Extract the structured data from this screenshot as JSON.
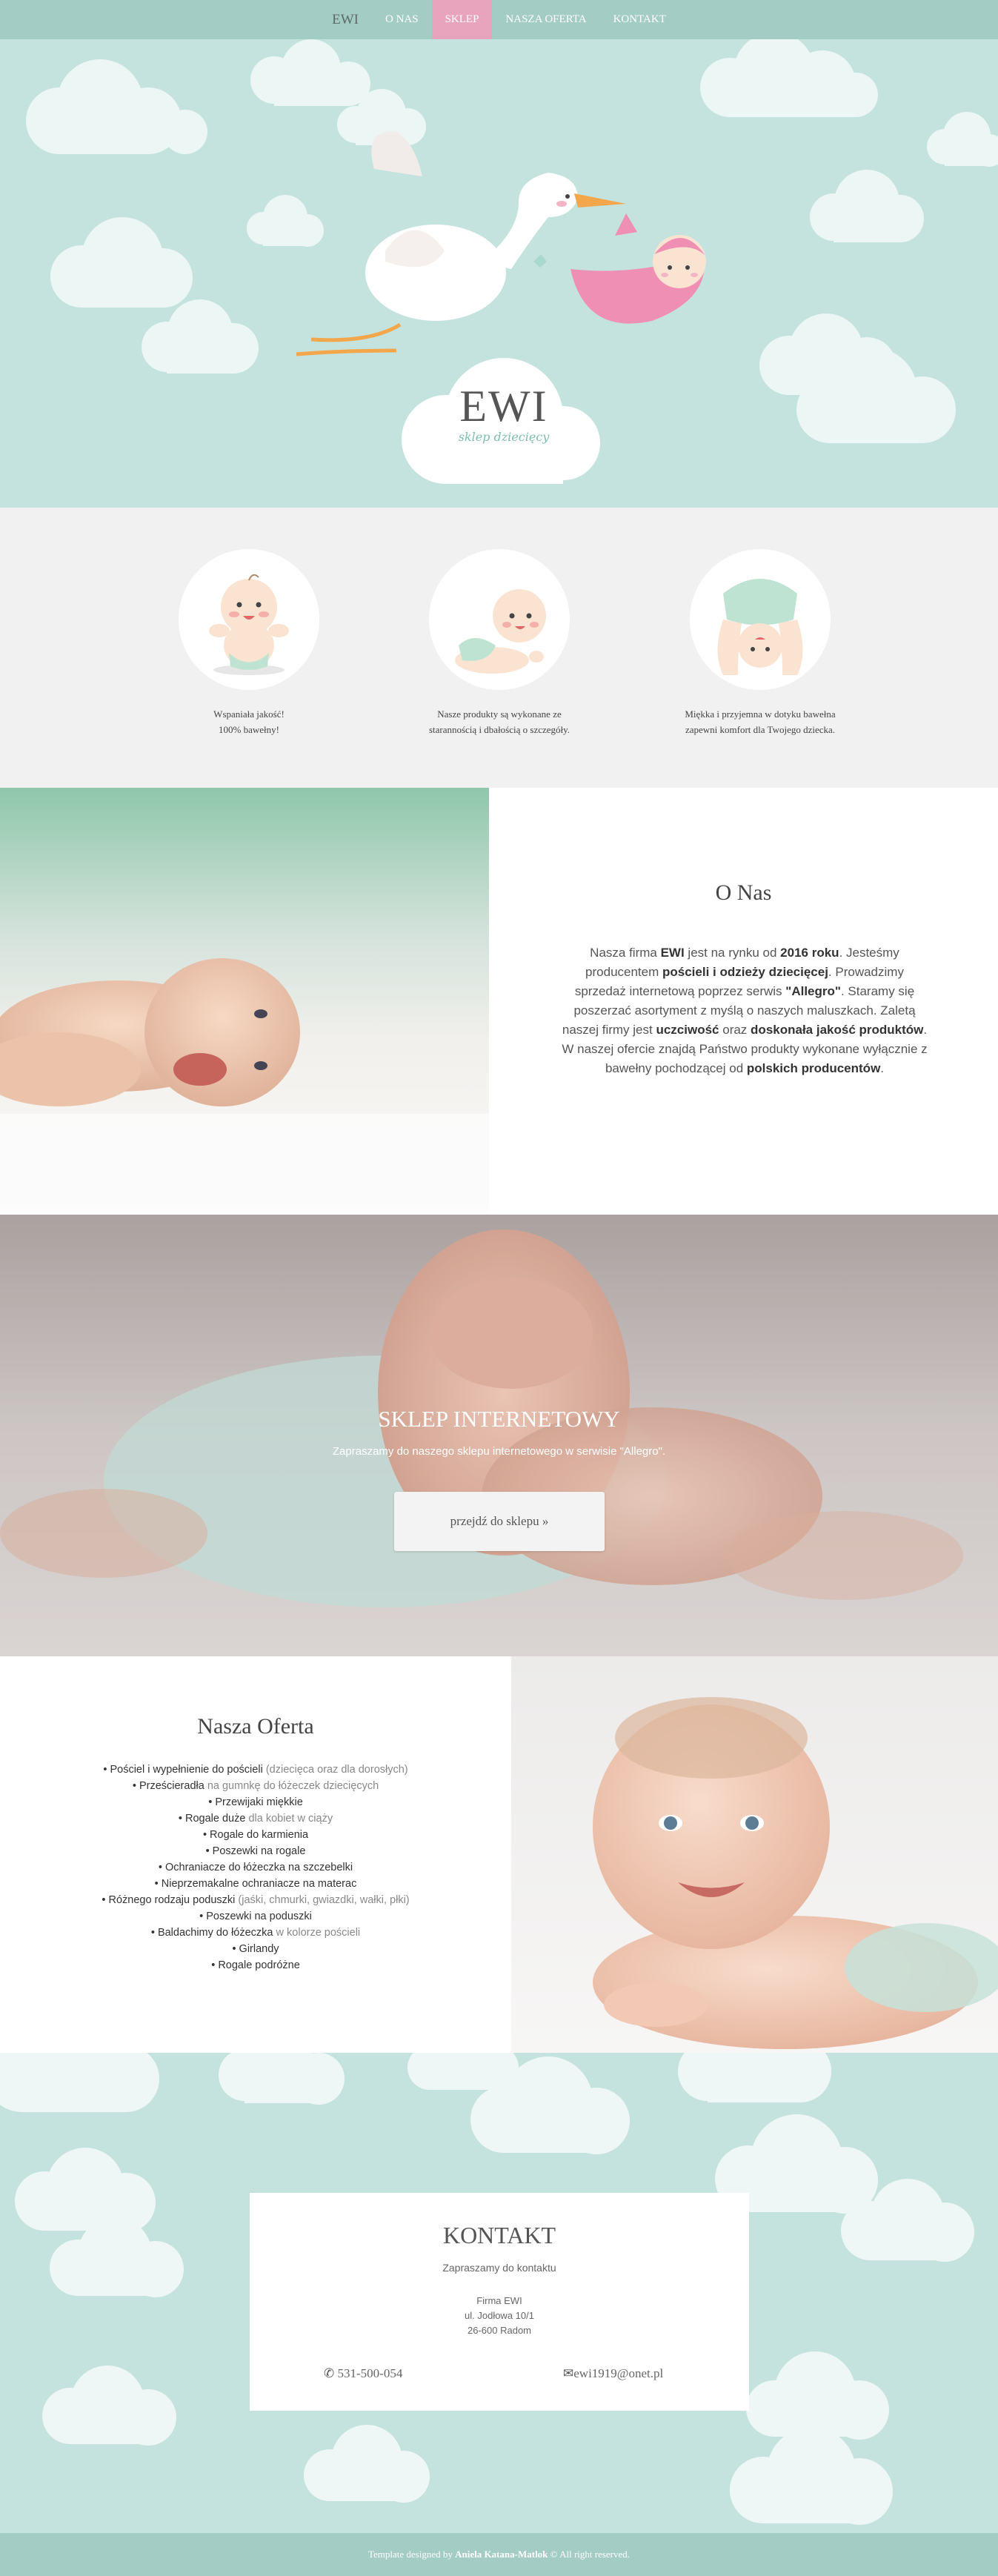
{
  "nav": {
    "brand": "EWI",
    "items": [
      "O NAS",
      "SKLEP",
      "NASZA OFERTA",
      "KONTAKT"
    ],
    "active_index": 1
  },
  "hero": {
    "logo_title": "EWI",
    "logo_subtitle": "sklep dziecięcy"
  },
  "features": [
    {
      "line1": "Wspaniała jakość!",
      "line2": "100% bawełny!"
    },
    {
      "line1": "Nasze produkty są wykonane ze",
      "line2": "starannością i dbałością o szczegóły."
    },
    {
      "line1": "Miękka i przyjemna w dotyku bawełna",
      "line2": "zapewni komfort dla Twojego dziecka."
    }
  ],
  "about": {
    "heading": "O Nas",
    "p1": "Nasza firma ",
    "b1": "EWI",
    "p2": " jest na rynku od ",
    "b2": "2016 roku",
    "p3": ". Jesteśmy producentem ",
    "b3": "pościeli i odzieży dziecięcej",
    "p4": ". Prowadzimy sprzedaż internetową poprzez serwis ",
    "b4": "\"Allegro\"",
    "p5": ". Staramy się poszerzać asortyment z myślą o naszych maluszkach. Zaletą naszej firmy jest ",
    "b5": "uczciwość",
    "p6": " oraz ",
    "b6": "doskonała jakość produktów",
    "p7": ". W naszej ofercie znajdą Państwo produkty wykonane wyłącznie z bawełny pochodzącej od ",
    "b7": "polskich producentów",
    "p8": "."
  },
  "shop": {
    "heading": "SKLEP INTERNETOWY",
    "subtitle": "Zapraszamy do naszego sklepu internetowego w serwisie \"Allegro\".",
    "button": "przejdź do sklepu »"
  },
  "offer": {
    "heading": "Nasza Oferta",
    "items": [
      {
        "main": "Pościel i wypełnienie do pościeli",
        "extra": " (dziecięca oraz dla dorosłych)"
      },
      {
        "main": "Prześcieradła",
        "extra": " na gumnkę do łóżeczek dziecięcych"
      },
      {
        "main": "Przewijaki miękkie",
        "extra": ""
      },
      {
        "main": "Rogale duże",
        "extra": " dla kobiet w ciąży"
      },
      {
        "main": "Rogale do karmienia",
        "extra": ""
      },
      {
        "main": "Poszewki na rogale",
        "extra": ""
      },
      {
        "main": "Ochraniacze do łóżeczka na szczebelki",
        "extra": ""
      },
      {
        "main": "Nieprzemakalne ochraniacze na materac",
        "extra": ""
      },
      {
        "main": "Różnego rodzaju poduszki",
        "extra": " (jaśki, chmurki, gwiazdki, wałki, płki)"
      },
      {
        "main": "Poszewki na poduszki",
        "extra": ""
      },
      {
        "main": "Baldachimy do łóżeczka",
        "extra": " w kolorze pościeli"
      },
      {
        "main": "Girlandy",
        "extra": ""
      },
      {
        "main": "Rogale podróżne",
        "extra": ""
      }
    ]
  },
  "contact": {
    "heading": "KONTAKT",
    "subtitle": "Zapraszamy do kontaktu",
    "company": "Firma EWI",
    "street": "ul. Jodłowa 10/1",
    "city": "26-600 Radom",
    "phone": "531-500-054",
    "email": "ewi1919@onet.pl"
  },
  "footer": {
    "prefix": "Template designed by ",
    "author": "Aniela Katana-Matlok",
    "suffix": " © All right reserved."
  },
  "colors": {
    "mint": "#c4e3de",
    "nav": "#a3ccc4",
    "pink_active": "#e8a4bc"
  },
  "icons": [
    "phone-icon",
    "mail-icon",
    "stork-illustration",
    "cloud-shape"
  ]
}
